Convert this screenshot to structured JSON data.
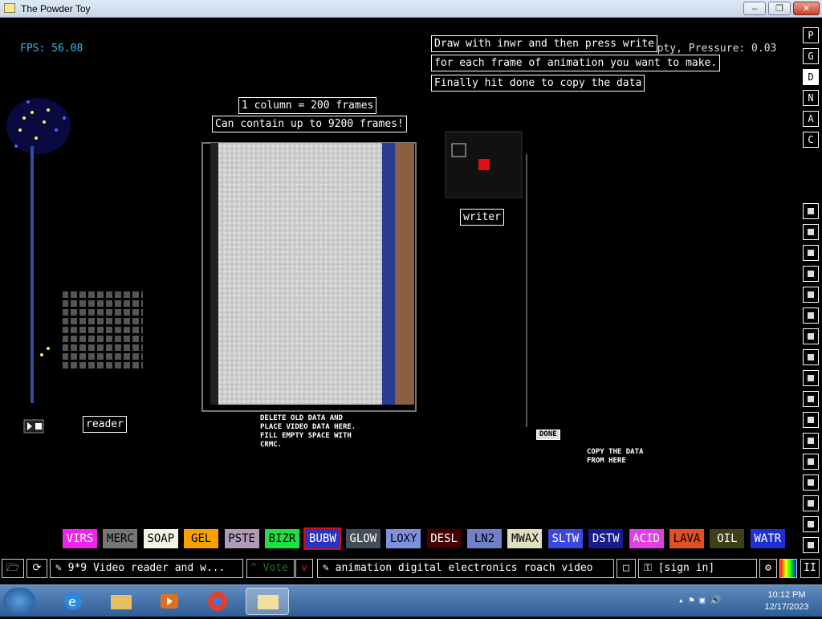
{
  "window": {
    "title": "The Powder Toy",
    "minimize": "‒",
    "maximize": "❐",
    "close": "✕"
  },
  "hud": {
    "fps": "FPS: 56.08",
    "info": "Empty, Pressure: 0.03"
  },
  "signs": {
    "instr1": "Draw with inwr and then press write",
    "instr2": "for each frame of animation you want to make.",
    "instr3": "Finally hit done to copy the data",
    "column": "1 column = 200 frames",
    "contain": "Can contain up to 9200 frames!",
    "writer": "writer",
    "reader": "reader",
    "done": "DONE"
  },
  "notes": {
    "delete": "DELETE OLD DATA AND\nPLACE VIDEO DATA HERE.\nFILL EMPTY SPACE WITH\nCRMC.",
    "copy": "COPY THE DATA\nFROM HERE"
  },
  "right_menu": [
    "P",
    "G",
    "D",
    "N",
    "A",
    "C"
  ],
  "tool_icons": [
    "wall-icon",
    "plug-icon",
    "power-icon",
    "sensor-icon",
    "force-icon",
    "spray-icon",
    "brush-icon",
    "liquid-icon",
    "gas-icon",
    "box-icon",
    "radioactive-icon",
    "star-icon",
    "particles-icon",
    "lightbulb-icon",
    "bookmark-icon",
    "hammer-icon",
    "search-icon"
  ],
  "elements": [
    {
      "label": "VIRS",
      "bg": "#ec24ec",
      "fg": "#ffffff"
    },
    {
      "label": "MERC",
      "bg": "#757575",
      "fg": "#000000"
    },
    {
      "label": "SOAP",
      "bg": "#f4f4e4",
      "fg": "#000000"
    },
    {
      "label": "GEL",
      "bg": "#f8a000",
      "fg": "#000000"
    },
    {
      "label": "PSTE",
      "bg": "#b09ab8",
      "fg": "#000000"
    },
    {
      "label": "BIZR",
      "bg": "#20e040",
      "fg": "#000000"
    },
    {
      "label": "BUBW",
      "bg": "#2a34c0",
      "fg": "#ffffff"
    },
    {
      "label": "GLOW",
      "bg": "#444e58",
      "fg": "#ffffff"
    },
    {
      "label": "LOXY",
      "bg": "#8090e0",
      "fg": "#000000"
    },
    {
      "label": "DESL",
      "bg": "#440000",
      "fg": "#ffffff"
    },
    {
      "label": "LN2",
      "bg": "#7080c8",
      "fg": "#000000"
    },
    {
      "label": "MWAX",
      "bg": "#e0e0c0",
      "fg": "#000000"
    },
    {
      "label": "SLTW",
      "bg": "#3a48e0",
      "fg": "#ffffff"
    },
    {
      "label": "DSTW",
      "bg": "#1a1a90",
      "fg": "#ffffff"
    },
    {
      "label": "ACID",
      "bg": "#e040e0",
      "fg": "#ffffff"
    },
    {
      "label": "LAVA",
      "bg": "#e05020",
      "fg": "#000000"
    },
    {
      "label": "OIL",
      "bg": "#404018",
      "fg": "#ffffff"
    },
    {
      "label": "WATR",
      "bg": "#2030d0",
      "fg": "#ffffff"
    }
  ],
  "selected_element": "BUBW",
  "bottom": {
    "save_title": "9*9 Video reader and w...",
    "vote": "Vote",
    "tags": "animation digital electronics roach video",
    "signin": "[sign in]"
  },
  "taskbar": {
    "time": "10:12 PM",
    "date": "12/17/2023"
  }
}
